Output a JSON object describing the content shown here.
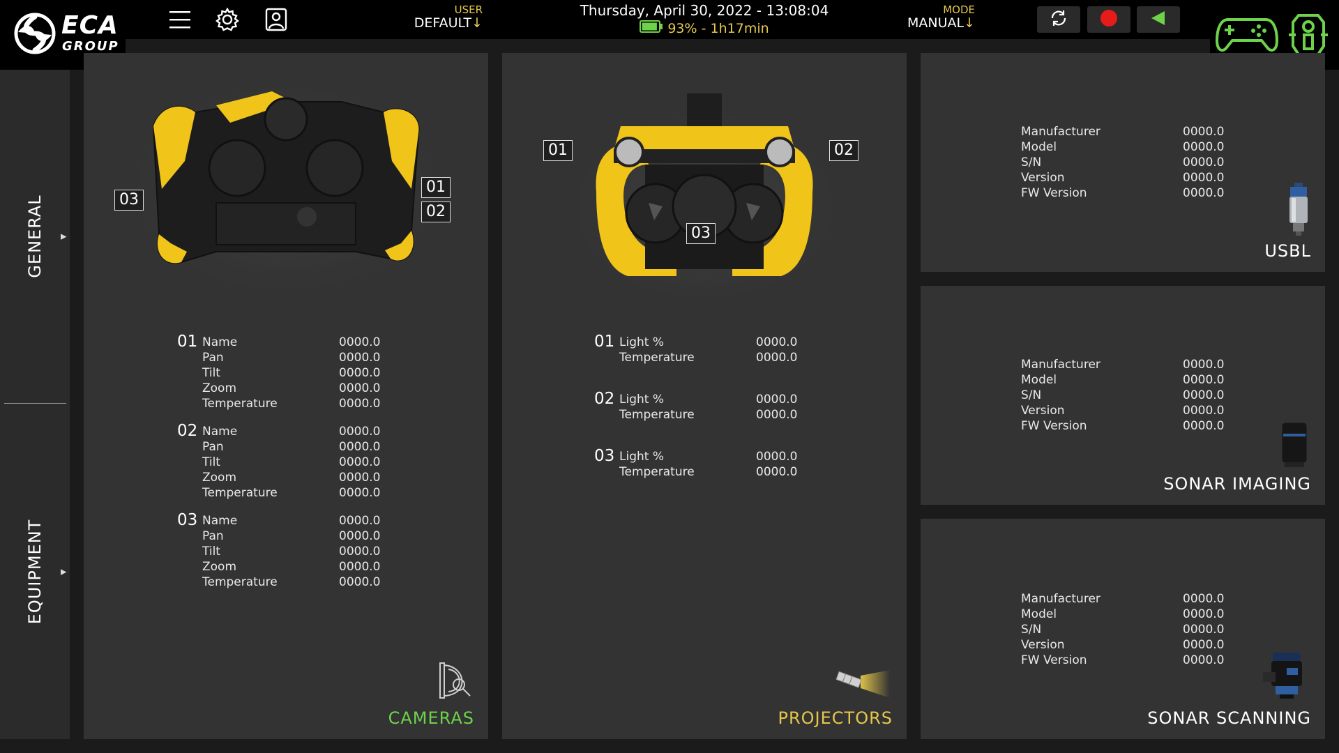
{
  "header": {
    "logo_text": "ECA",
    "logo_sub": "GROUP",
    "user": {
      "label": "USER",
      "value": "DEFAULT",
      "arrow": "↓"
    },
    "datetime": "Thursday, April 30, 2022 - 13:08:04",
    "battery": {
      "text": "93% - 1h17min",
      "percent": 93
    },
    "mode": {
      "label": "MODE",
      "value": "MANUAL",
      "arrow": "↓"
    },
    "icons": [
      "menu-icon",
      "settings-gear-icon",
      "user-profile-icon",
      "refresh-icon",
      "record-icon",
      "play-back-icon",
      "gamepad-icon",
      "rov-icon"
    ]
  },
  "sidebar": {
    "items": [
      {
        "label": "GENERAL",
        "arrow": "▶"
      },
      {
        "label": "EQUIPMENT",
        "arrow": "▶"
      }
    ]
  },
  "cameras": {
    "title": "CAMERAS",
    "tags": [
      "01",
      "02",
      "03"
    ],
    "groups": [
      {
        "id": "01",
        "rows": [
          {
            "label": "Name",
            "value": "0000.0"
          },
          {
            "label": "Pan",
            "value": "0000.0"
          },
          {
            "label": "Tilt",
            "value": "0000.0"
          },
          {
            "label": "Zoom",
            "value": "0000.0"
          },
          {
            "label": "Temperature",
            "value": "0000.0"
          }
        ]
      },
      {
        "id": "02",
        "rows": [
          {
            "label": "Name",
            "value": "0000.0"
          },
          {
            "label": "Pan",
            "value": "0000.0"
          },
          {
            "label": "Tilt",
            "value": "0000.0"
          },
          {
            "label": "Zoom",
            "value": "0000.0"
          },
          {
            "label": "Temperature",
            "value": "0000.0"
          }
        ]
      },
      {
        "id": "03",
        "rows": [
          {
            "label": "Name",
            "value": "0000.0"
          },
          {
            "label": "Pan",
            "value": "0000.0"
          },
          {
            "label": "Tilt",
            "value": "0000.0"
          },
          {
            "label": "Zoom",
            "value": "0000.0"
          },
          {
            "label": "Temperature",
            "value": "0000.0"
          }
        ]
      }
    ]
  },
  "projectors": {
    "title": "PROJECTORS",
    "tags": [
      "01",
      "02",
      "03"
    ],
    "groups": [
      {
        "id": "01",
        "rows": [
          {
            "label": "Light %",
            "value": "0000.0"
          },
          {
            "label": "Temperature",
            "value": "0000.0"
          }
        ]
      },
      {
        "id": "02",
        "rows": [
          {
            "label": "Light %",
            "value": "0000.0"
          },
          {
            "label": "Temperature",
            "value": "0000.0"
          }
        ]
      },
      {
        "id": "03",
        "rows": [
          {
            "label": "Light %",
            "value": "0000.0"
          },
          {
            "label": "Temperature",
            "value": "0000.0"
          }
        ]
      }
    ]
  },
  "usbl": {
    "title": "USBL",
    "rows": [
      {
        "label": "Manufacturer",
        "value": "0000.0"
      },
      {
        "label": "Model",
        "value": "0000.0"
      },
      {
        "label": "S/N",
        "value": "0000.0"
      },
      {
        "label": "Version",
        "value": "0000.0"
      },
      {
        "label": "FW Version",
        "value": "0000.0"
      }
    ]
  },
  "sonar_imaging": {
    "title": "SONAR IMAGING",
    "rows": [
      {
        "label": "Manufacturer",
        "value": "0000.0"
      },
      {
        "label": "Model",
        "value": "0000.0"
      },
      {
        "label": "S/N",
        "value": "0000.0"
      },
      {
        "label": "Version",
        "value": "0000.0"
      },
      {
        "label": "FW Version",
        "value": "0000.0"
      }
    ]
  },
  "sonar_scanning": {
    "title": "SONAR SCANNING",
    "rows": [
      {
        "label": "Manufacturer",
        "value": "0000.0"
      },
      {
        "label": "Model",
        "value": "0000.0"
      },
      {
        "label": "S/N",
        "value": "0000.0"
      },
      {
        "label": "Version",
        "value": "0000.0"
      },
      {
        "label": "FW Version",
        "value": "0000.0"
      }
    ]
  },
  "colors": {
    "accent_yellow": "#e5c84a",
    "accent_green": "#6ed34a",
    "record_red": "#e81b1b",
    "panel_bg": "#333333",
    "page_bg": "#1b1b1b"
  }
}
